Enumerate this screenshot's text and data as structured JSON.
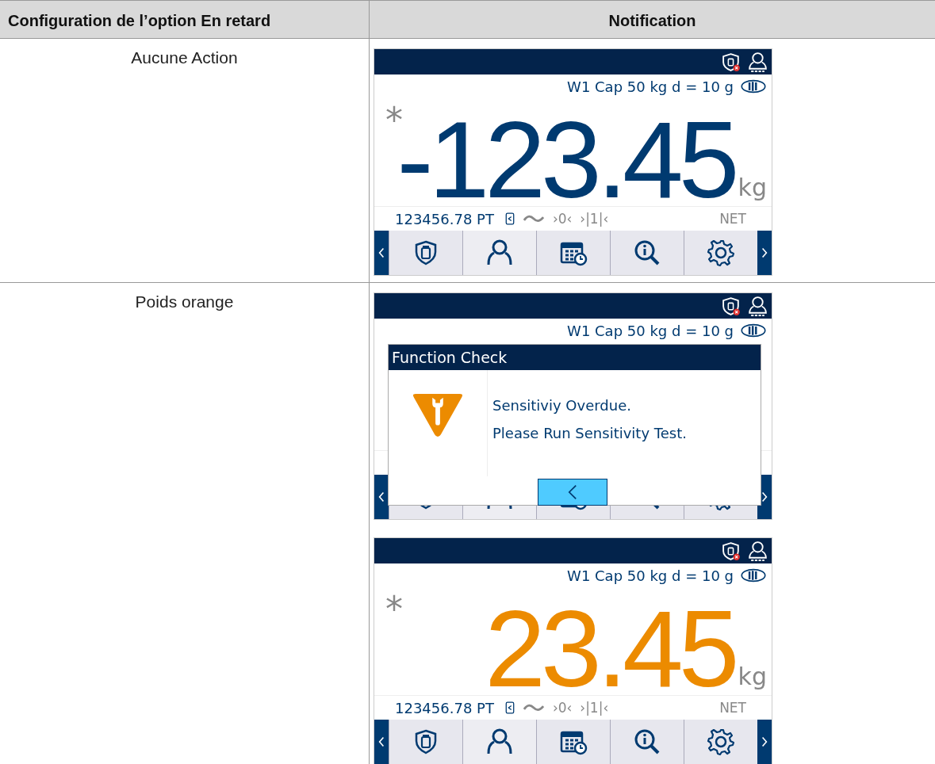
{
  "table": {
    "columns": [
      "Configuration de l’option En retard",
      "Notification"
    ],
    "rows": [
      {
        "setting": "Aucune Action",
        "screens": [
          {
            "kind": "normal",
            "scale_info": "W1 Cap 50 kg d = 10 g",
            "asterisk": "*",
            "weight": "-123.45",
            "unit": "kg",
            "status": {
              "tare": "123456.78 PT",
              "zero": "›0‹",
              "range": "›|1|‹",
              "mode": "NET"
            }
          }
        ]
      },
      {
        "setting": "Poids orange",
        "screens": [
          {
            "scale_info": "W1 Cap 50 kg d = 10 g",
            "dialog": {
              "title": "Function Check",
              "lines": [
                "Sensitiviy Overdue.",
                "Please Run Sensitivity Test."
              ]
            }
          },
          {
            "kind": "orange",
            "scale_info": "W1 Cap 50 kg d = 10 g",
            "asterisk": "*",
            "weight": "23.45",
            "unit": "kg",
            "status": {
              "tare": "123456.78 PT",
              "zero": "›0‹",
              "range": "›|1|‹",
              "mode": "NET"
            }
          }
        ]
      }
    ]
  }
}
